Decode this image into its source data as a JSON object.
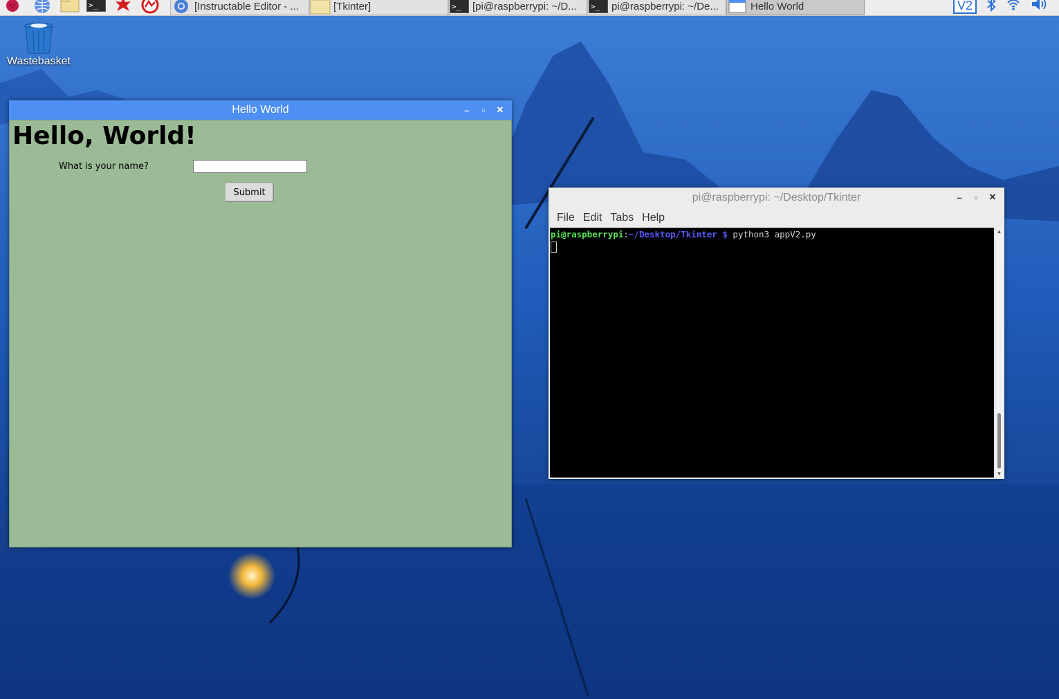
{
  "taskbar": {
    "launchers": [
      {
        "icon": "raspberry-menu-icon"
      },
      {
        "icon": "web-browser-icon"
      },
      {
        "icon": "file-manager-icon"
      },
      {
        "icon": "terminal-icon"
      },
      {
        "icon": "mathematica-icon"
      },
      {
        "icon": "wolfram-icon"
      }
    ],
    "tasks": [
      {
        "label": "[Instructable Editor - ...",
        "icon": "chromium-icon",
        "active": false
      },
      {
        "label": "[Tkinter]",
        "icon": "folder-icon",
        "active": false
      },
      {
        "label": "[pi@raspberrypi: ~/D...",
        "icon": "terminal-icon",
        "active": false
      },
      {
        "label": "pi@raspberrypi: ~/De...",
        "icon": "terminal-icon",
        "active": false
      },
      {
        "label": "Hello World",
        "icon": "window-icon",
        "active": true
      }
    ],
    "tray": [
      {
        "icon": "vnc-icon",
        "text": "V2"
      },
      {
        "icon": "bluetooth-icon"
      },
      {
        "icon": "wifi-icon"
      },
      {
        "icon": "volume-icon"
      }
    ]
  },
  "desktop": {
    "icons": [
      {
        "label": "Wastebasket",
        "icon": "wastebasket-icon"
      }
    ]
  },
  "hello_window": {
    "title": "Hello World",
    "heading": "Hello, World!",
    "name_label": "What is your name?",
    "name_value": "",
    "submit_label": "Submit",
    "background_color": "#9bba96"
  },
  "terminal_window": {
    "title": "pi@raspberrypi: ~/Desktop/Tkinter",
    "menu": [
      "File",
      "Edit",
      "Tabs",
      "Help"
    ],
    "prompt_user": "pi@raspberrypi",
    "prompt_sep": ":",
    "prompt_path": "~/Desktop/Tkinter $",
    "command": " python3 appV2.py"
  },
  "colors": {
    "titlebar_active": "#4d8ff2",
    "terminal_bg": "#000000",
    "prompt_user": "#55e655",
    "prompt_path": "#5a5aff"
  }
}
